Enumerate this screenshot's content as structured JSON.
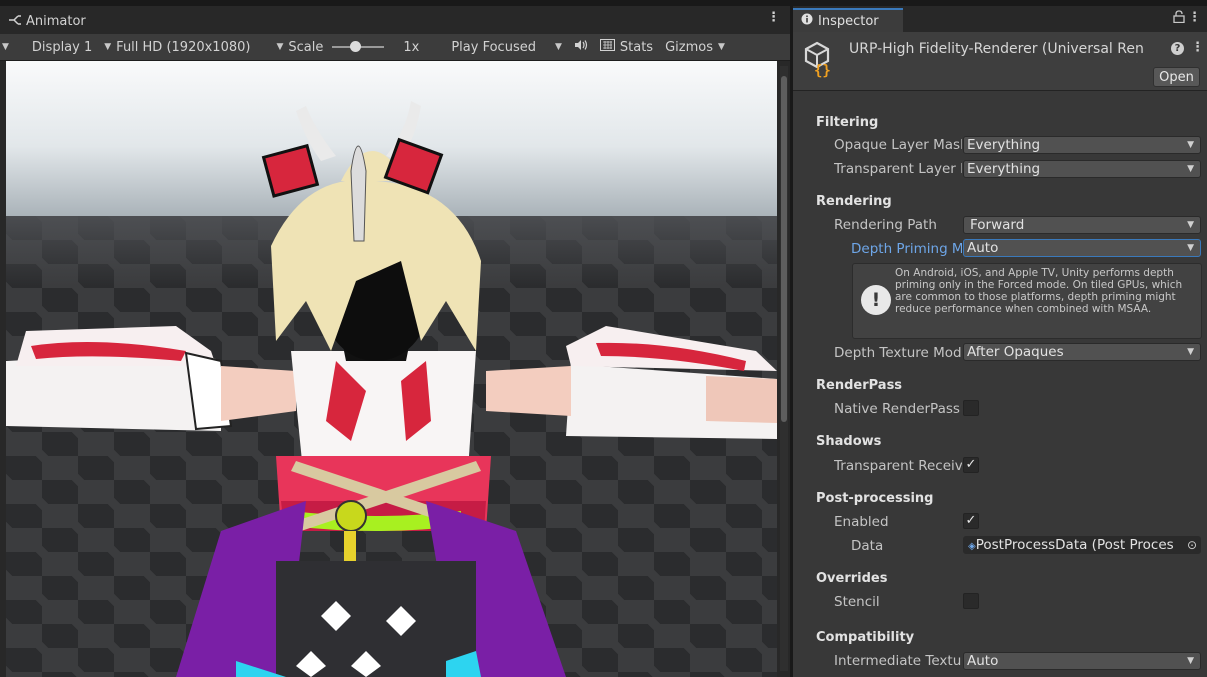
{
  "game_view": {
    "tab_label": "Animator",
    "toolbar": {
      "display": "Display 1",
      "resolution": "Full HD (1920x1080)",
      "scale_label": "Scale",
      "scale_value": "1x",
      "play_mode": "Play Focused",
      "stats": "Stats",
      "gizmos": "Gizmos"
    }
  },
  "inspector": {
    "tab_label": "Inspector",
    "asset_title": "URP-High Fidelity-Renderer (Universal Ren",
    "open_button": "Open",
    "sections": {
      "filtering": "Filtering",
      "rendering": "Rendering",
      "renderpass": "RenderPass",
      "shadows": "Shadows",
      "post_processing": "Post-processing",
      "overrides": "Overrides",
      "compatibility": "Compatibility"
    },
    "props": {
      "opaque_layer_mask": {
        "label": "Opaque Layer Masl",
        "value": "Everything"
      },
      "transparent_layer_mask": {
        "label": "Transparent Layer I",
        "value": "Everything"
      },
      "rendering_path": {
        "label": "Rendering Path",
        "value": "Forward"
      },
      "depth_priming_mode": {
        "label": "Depth Priming M",
        "value": "Auto"
      },
      "depth_texture_mode": {
        "label": "Depth Texture Mod",
        "value": "After Opaques"
      },
      "native_renderpass": {
        "label": "Native RenderPass",
        "checked": false
      },
      "transparent_receive_shadows": {
        "label": "Transparent Receiv",
        "checked": true
      },
      "pp_enabled": {
        "label": "Enabled",
        "checked": true
      },
      "pp_data": {
        "label": "Data",
        "value": "PostProcessData (Post Proces"
      },
      "stencil": {
        "label": "Stencil",
        "checked": false
      },
      "intermediate_texture": {
        "label": "Intermediate Textur",
        "value": "Auto"
      }
    },
    "helpbox_text": "On Android, iOS, and Apple TV, Unity performs depth priming only in the Forced mode. On tiled GPUs, which are common to those platforms, depth priming might reduce performance when combined with MSAA."
  },
  "colors": {
    "accent": "#3a79bb",
    "link_label": "#6ea6e8",
    "panel_bg": "#383838"
  }
}
